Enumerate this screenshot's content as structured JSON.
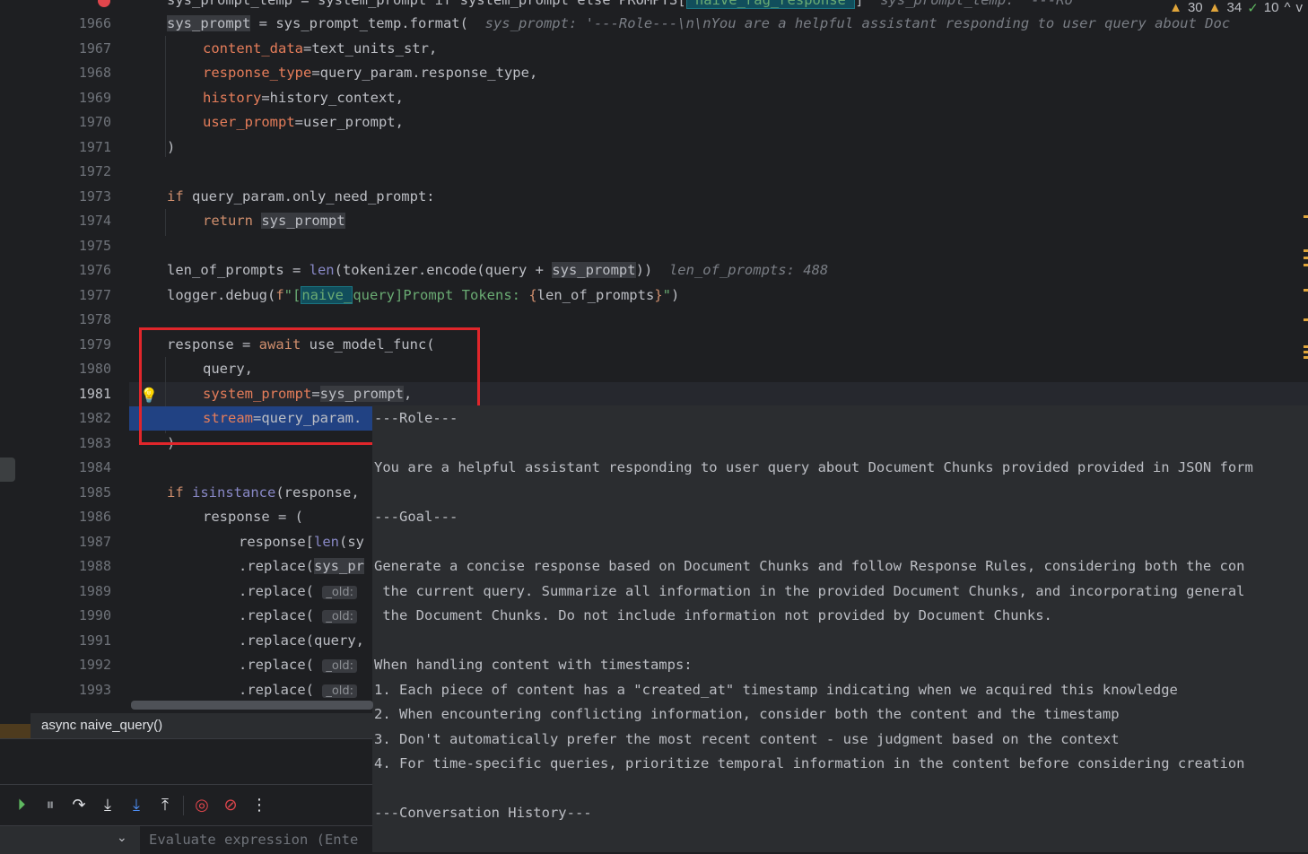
{
  "inspections": {
    "warnings_a": "30",
    "warnings_b": "34",
    "ok": "10",
    "up": "^",
    "down": "v"
  },
  "gutter": {
    "lines": [
      "1966",
      "1967",
      "1968",
      "1969",
      "1970",
      "1971",
      "1972",
      "1973",
      "1974",
      "1975",
      "1976",
      "1977",
      "1978",
      "1979",
      "1980",
      "1981",
      "1982",
      "1983",
      "1984",
      "1985",
      "1986",
      "1987",
      "1988",
      "1989",
      "1990",
      "1991",
      "1992",
      "1993"
    ],
    "current": "1981"
  },
  "code": {
    "top_partial": {
      "a": "sys_prompt_temp = system_prompt if system_prompt else PROMPTS[",
      "tag": "\"naive_rag_response\"",
      "b": "]  ",
      "hint": "sys_prompt_temp: '---Ro"
    },
    "l1966": {
      "var": "sys_prompt",
      "rest": " = sys_prompt_temp.format(  ",
      "hint": "sys_prompt: '---Role---\\n\\nYou are a helpful assistant responding to user query about Doc"
    },
    "l1967": {
      "param": "content_data",
      "rest": "=text_units_str,"
    },
    "l1968": {
      "param": "response_type",
      "rest": "=query_param.response_type,"
    },
    "l1969": {
      "param": "history",
      "rest": "=history_context,"
    },
    "l1970": {
      "param": "user_prompt",
      "rest": "=user_prompt,"
    },
    "l1971": ")",
    "l1973": {
      "kw": "if",
      "rest": " query_param.only_need_prompt:"
    },
    "l1974": {
      "kw": "return",
      "var": "sys_prompt"
    },
    "l1976": {
      "a": "len_of_prompts = ",
      "builtin": "len",
      "b": "(tokenizer.encode(query + ",
      "var": "sys_prompt",
      "c": "))  ",
      "hint": "len_of_prompts: 488"
    },
    "l1977": {
      "a": "logger.debug(",
      "f": "f",
      "s1": "\"[",
      "tag": "naive_",
      "s2": "query]Prompt Tokens: ",
      "brace1": "{",
      "expr": "len_of_prompts",
      "brace2": "}",
      "s3": "\"",
      "b": ")"
    },
    "l1979": {
      "a": "response = ",
      "kw": "await",
      "b": " use_model_func("
    },
    "l1980": "query,",
    "l1981": {
      "param": "system_prompt",
      "eq": "=",
      "var": "sys_prompt",
      "b": ","
    },
    "l1982": {
      "param": "stream",
      "rest": "=query_param."
    },
    "l1983": ")",
    "l1985": {
      "kw": "if",
      "builtin": "isinstance",
      "rest": "(response,"
    },
    "l1986": "response = (",
    "l1987": {
      "a": "response[",
      "builtin": "len",
      "b": "(sy"
    },
    "l1988": {
      "a": ".replace(",
      "b": "sys_pr"
    },
    "l1989": {
      "a": ".replace( ",
      "chip": "_old:"
    },
    "l1990": {
      "a": ".replace( ",
      "chip": "_old:"
    },
    "l1991": ".replace(query,",
    "l1992": {
      "a": ".replace( ",
      "chip": "_old:"
    },
    "l1993": {
      "a": ".replace( ",
      "chip": "_old:"
    }
  },
  "tooltip": {
    "lines": [
      "---Role---",
      "",
      "You are a helpful assistant responding to user query about Document Chunks provided provided in JSON form",
      "",
      "---Goal---",
      "",
      "Generate a concise response based on Document Chunks and follow Response Rules, considering both the con",
      " the current query. Summarize all information in the provided Document Chunks, and incorporating general",
      " the Document Chunks. Do not include information not provided by Document Chunks.",
      "",
      "When handling content with timestamps:",
      "1. Each piece of content has a \"created_at\" timestamp indicating when we acquired this knowledge",
      "2. When encountering conflicting information, consider both the content and the timestamp",
      "3. Don't automatically prefer the most recent content - use judgment based on the context",
      "4. For time-specific queries, prioritize temporal information in the content before considering creation",
      "",
      "---Conversation History---"
    ]
  },
  "breadcrumb": "async naive_query()",
  "debug": {
    "eval_placeholder": "Evaluate expression (Ente"
  }
}
